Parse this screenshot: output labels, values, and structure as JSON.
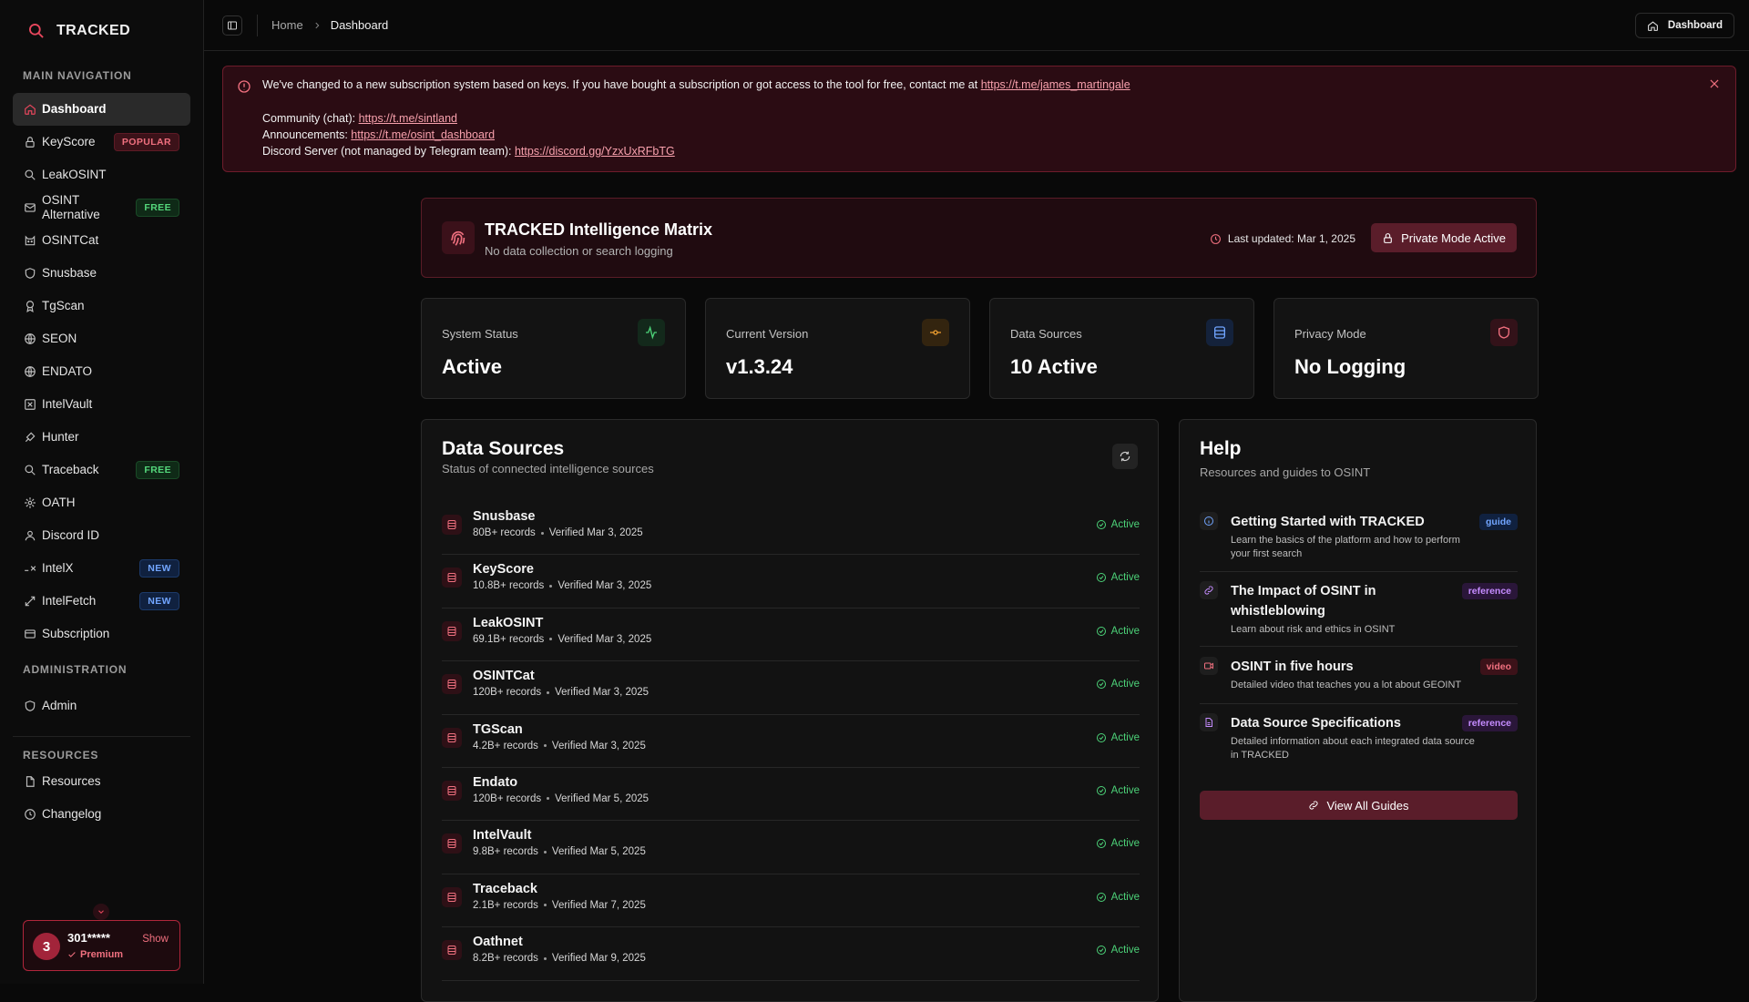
{
  "brand": {
    "name": "TRACKED"
  },
  "sidebar": {
    "main_title": "MAIN NAVIGATION",
    "items": [
      {
        "label": "Dashboard",
        "icon": "home-icon"
      },
      {
        "label": "KeyScore",
        "icon": "lock-icon",
        "tag": "POPULAR"
      },
      {
        "label": "LeakOSINT",
        "icon": "search-icon"
      },
      {
        "label": "OSINT Alternative",
        "icon": "mail-icon",
        "tag": "FREE"
      },
      {
        "label": "OSINTCat",
        "icon": "cat-icon"
      },
      {
        "label": "Snusbase",
        "icon": "shield-icon"
      },
      {
        "label": "TgScan",
        "icon": "badge-icon"
      },
      {
        "label": "SEON",
        "icon": "globe-icon"
      },
      {
        "label": "ENDATO",
        "icon": "globe-icon"
      },
      {
        "label": "IntelVault",
        "icon": "vault-icon"
      },
      {
        "label": "Hunter",
        "icon": "target-icon"
      },
      {
        "label": "Traceback",
        "icon": "search-icon",
        "tag": "FREE"
      },
      {
        "label": "OATH",
        "icon": "gear-icon"
      },
      {
        "label": "Discord ID",
        "icon": "user-icon"
      },
      {
        "label": "IntelX",
        "icon": "x-icon",
        "tag": "NEW"
      },
      {
        "label": "IntelFetch",
        "icon": "arrows-icon",
        "tag": "NEW"
      },
      {
        "label": "Subscription",
        "icon": "card-icon"
      }
    ],
    "admin_title": "ADMINISTRATION",
    "admin_items": [
      {
        "label": "Admin",
        "icon": "shield-icon"
      }
    ],
    "resources_title": "RESOURCES",
    "resource_items": [
      {
        "label": "Resources",
        "icon": "file-icon"
      },
      {
        "label": "Changelog",
        "icon": "clock-icon"
      }
    ],
    "user": {
      "avatar": "3",
      "name": "301*****",
      "plan": "Premium",
      "show": "Show"
    }
  },
  "topbar": {
    "crumbs": [
      "Home",
      "Dashboard"
    ],
    "button": "Dashboard"
  },
  "alert": {
    "line1": "We've changed to a new subscription system based on keys. If you have bought a subscription or got access to the tool for free, contact me at ",
    "line1_link": "https://t.me/james_martingale",
    "community_label": "Community (chat): ",
    "community_link": "https://t.me/sintland",
    "ann_label": "Announcements: ",
    "ann_link": "https://t.me/osint_dashboard",
    "discord_label": "Discord Server (not managed by Telegram team): ",
    "discord_link": "https://discord.gg/YzxUxRFbTG"
  },
  "matrix": {
    "title": "TRACKED Intelligence Matrix",
    "subtitle": "No data collection or search logging",
    "updated": "Last updated: Mar 1, 2025",
    "button": "Private Mode Active"
  },
  "stats": [
    {
      "label": "System Status",
      "value": "Active",
      "icon": "activity-icon",
      "color": "#4cd278",
      "bg": "#13291b"
    },
    {
      "label": "Current Version",
      "value": "v1.3.24",
      "icon": "commit-icon",
      "color": "#f0a030",
      "bg": "#33240f"
    },
    {
      "label": "Data Sources",
      "value": "10 Active",
      "icon": "database-icon",
      "color": "#71a5ff",
      "bg": "#14223b"
    },
    {
      "label": "Privacy Mode",
      "value": "No Logging",
      "icon": "shield-icon",
      "color": "#f0707f",
      "bg": "#331219"
    }
  ],
  "data_sources": {
    "title": "Data Sources",
    "subtitle": "Status of connected intelligence sources",
    "rows": [
      {
        "name": "Snusbase",
        "records": "80B+ records",
        "verified": "Verified Mar 3, 2025",
        "status": "Active"
      },
      {
        "name": "KeyScore",
        "records": "10.8B+ records",
        "verified": "Verified Mar 3, 2025",
        "status": "Active"
      },
      {
        "name": "LeakOSINT",
        "records": "69.1B+ records",
        "verified": "Verified Mar 3, 2025",
        "status": "Active"
      },
      {
        "name": "OSINTCat",
        "records": "120B+ records",
        "verified": "Verified Mar 3, 2025",
        "status": "Active"
      },
      {
        "name": "TGScan",
        "records": "4.2B+ records",
        "verified": "Verified Mar 3, 2025",
        "status": "Active"
      },
      {
        "name": "Endato",
        "records": "120B+ records",
        "verified": "Verified Mar 5, 2025",
        "status": "Active"
      },
      {
        "name": "IntelVault",
        "records": "9.8B+ records",
        "verified": "Verified Mar 5, 2025",
        "status": "Active"
      },
      {
        "name": "Traceback",
        "records": "2.1B+ records",
        "verified": "Verified Mar 7, 2025",
        "status": "Active"
      },
      {
        "name": "Oathnet",
        "records": "8.2B+ records",
        "verified": "Verified Mar 9, 2025",
        "status": "Active"
      }
    ]
  },
  "help": {
    "title": "Help",
    "subtitle": "Resources and guides to OSINT",
    "guides": [
      {
        "title": "Getting Started with TRACKED",
        "desc": "Learn the basics of the platform and how to perform your first search",
        "tag": "guide",
        "icon": "info-icon"
      },
      {
        "title": "The Impact of OSINT in whistleblowing",
        "desc": "Learn about risk and ethics in OSINT",
        "tag": "reference",
        "icon": "link-icon"
      },
      {
        "title": "OSINT in five hours",
        "desc": "Detailed video that teaches you a lot about GEOINT",
        "tag": "video",
        "icon": "video-icon"
      },
      {
        "title": "Data Source Specifications",
        "desc": "Detailed information about each integrated data source in TRACKED",
        "tag": "reference",
        "icon": "document-icon"
      }
    ],
    "button": "View All Guides"
  }
}
